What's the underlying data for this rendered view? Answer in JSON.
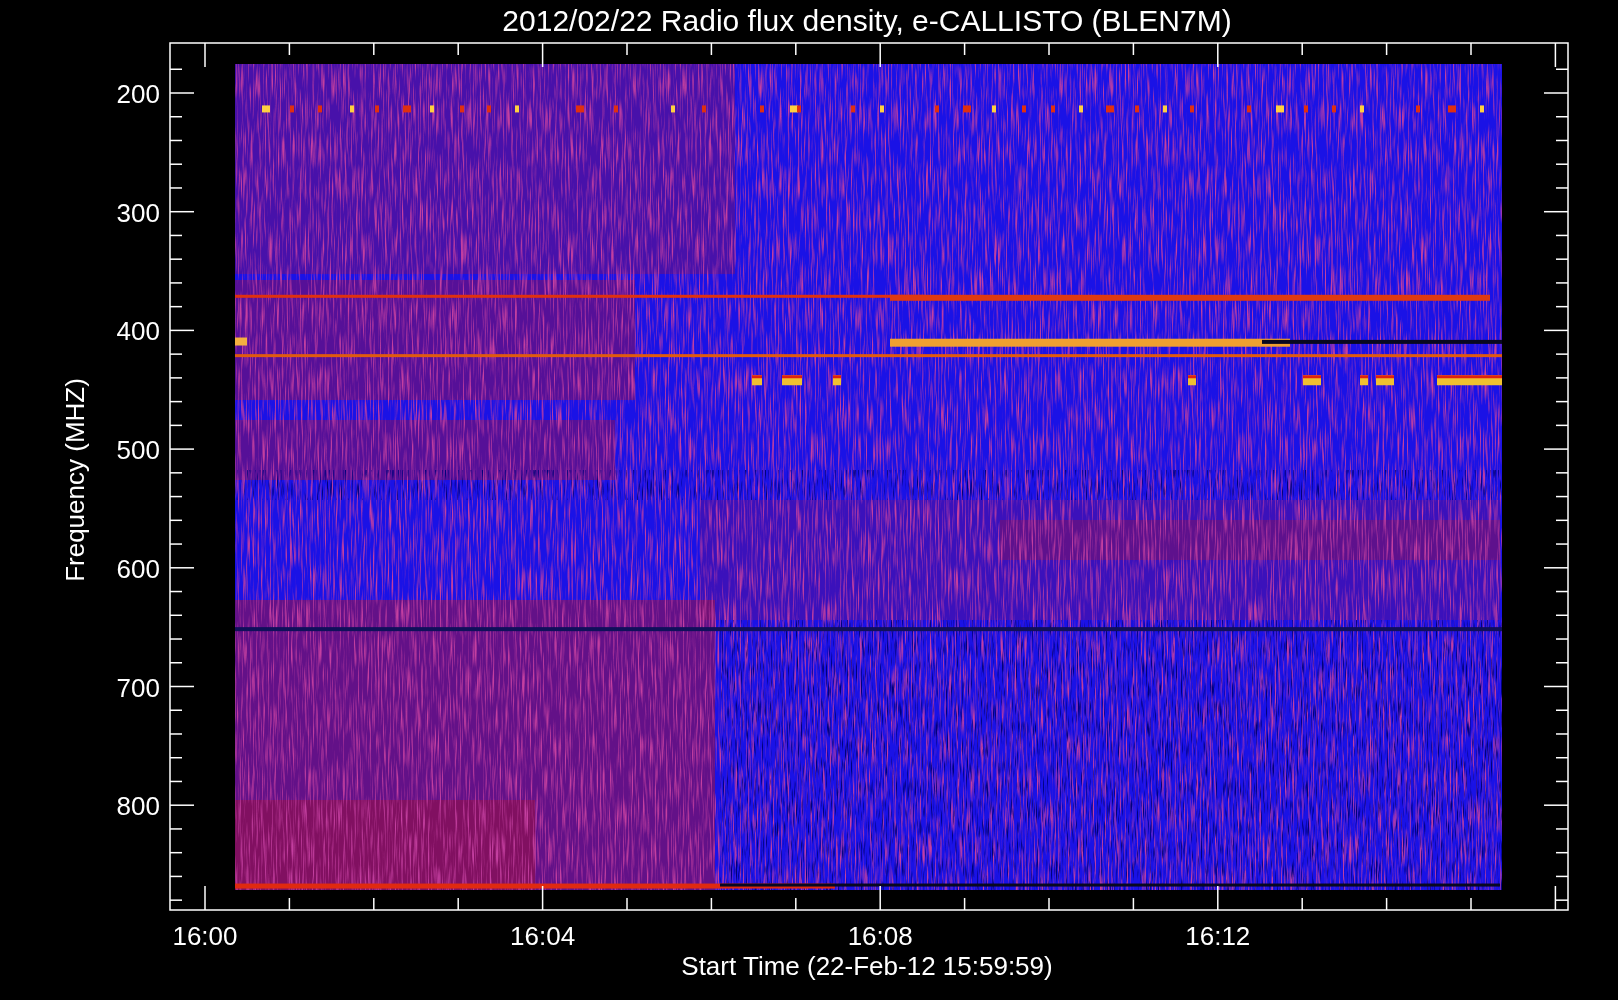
{
  "title": "2012/02/22  Radio flux density, e-CALLISTO (BLEN7M)",
  "y_axis": {
    "label": "Frequency (MHZ)",
    "ticks": [
      "200",
      "300",
      "400",
      "500",
      "600",
      "700",
      "800"
    ]
  },
  "x_axis": {
    "label": "Start Time (22-Feb-12 15:59:59)",
    "ticks": [
      "16:00",
      "16:04",
      "16:08",
      "16:12"
    ]
  }
}
